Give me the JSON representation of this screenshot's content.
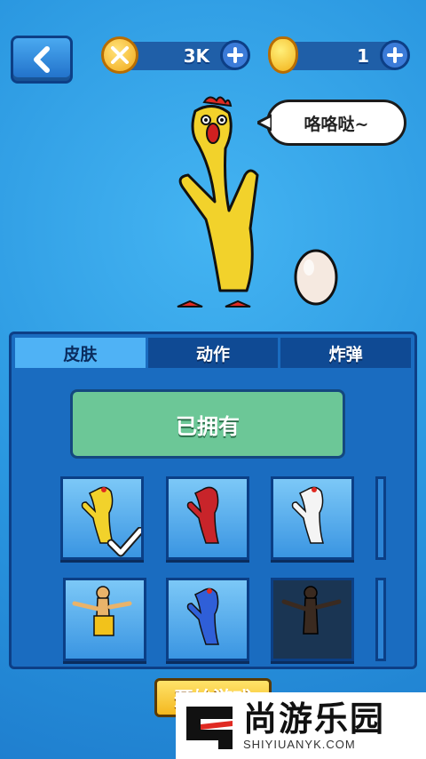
{
  "header": {
    "coins_value": "3K",
    "gems_value": "1"
  },
  "speech_bubble": "咯咯哒~",
  "tabs": [
    {
      "label": "皮肤",
      "active": true
    },
    {
      "label": "动作",
      "active": false
    },
    {
      "label": "炸弹",
      "active": false
    }
  ],
  "owned_label": "已拥有",
  "skins": [
    {
      "name": "yellow-chicken",
      "color": "#f2d22b",
      "selected": true
    },
    {
      "name": "red-chicken",
      "color": "#c8242a",
      "selected": false
    },
    {
      "name": "white-chicken",
      "color": "#f4f4f4",
      "selected": false
    },
    {
      "name": "player-chicken",
      "color": "#e9b36a",
      "selected": false
    },
    {
      "name": "blue-chicken",
      "color": "#2f5fd8",
      "selected": false
    },
    {
      "name": "dark-chicken",
      "color": "#3a2a20",
      "selected": false
    }
  ],
  "start_button": "开始游戏",
  "watermark": {
    "title": "尚游乐园",
    "subtitle": "SHIYIUANYK.COM"
  },
  "colors": {
    "background": "#2f9ee8",
    "panel": "#1a6cc0",
    "owned": "#6cc797",
    "accent": "#f4b81f"
  }
}
